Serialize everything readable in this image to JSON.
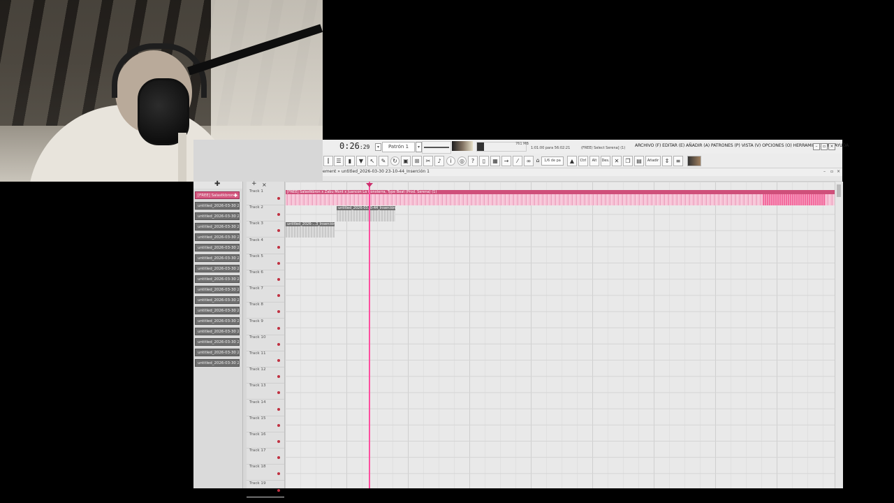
{
  "top_bar": {
    "time_main": "0:26",
    "time_sub": "29",
    "time_label": "M:S:CS",
    "pattern": "Patrón 1",
    "memory": "761 MB",
    "cpu_value": "72",
    "hint_time": "1:01:00 para 56:02:21",
    "hint_select": "(FREE) Select   Serena] (1)",
    "menu": "ARCHIVO (F)  EDITAR (E)  AÑADIR (A)  PATRONES (P)  VISTA (V)  OPCIONES (O)  HERRAMIENTAS (T)  AYUDA",
    "snap": "1/6 de pa"
  },
  "toolbar": {
    "icons": [
      "mixer-icon",
      "playlist-icon",
      "piano-icon",
      "plugin-icon",
      "cursor-icon",
      "brush-icon",
      "loop-icon",
      "save-icon",
      "cut-icon",
      "scissors-icon",
      "mic-icon",
      "info-icon",
      "help-icon",
      "question-icon",
      "doc-icon",
      "keyboard-icon",
      "arrow-right-icon",
      "pencil-icon",
      "link-icon"
    ],
    "right_buttons": [
      "Ctrl",
      "Alt",
      "Des.",
      "Añadir"
    ]
  },
  "playlist": {
    "breadcrumb": "ement » untitled_2026-03-30 23-10-44_Inserción 1"
  },
  "left_panel": {
    "clips": [
      {
        "label": "[FREE] Salastkbron a...",
        "active": true
      },
      {
        "label": "untitled_2026-03-30 23-...",
        "active": false
      },
      {
        "label": "untitled_2026-03-30 23-...",
        "active": false
      },
      {
        "label": "untitled_2026-03-30 23-...",
        "active": false
      },
      {
        "label": "untitled_2026-03-30 23-...",
        "active": false
      },
      {
        "label": "untitled_2026-03-30 23-...",
        "active": false
      },
      {
        "label": "untitled_2026-03-30 23-...",
        "active": false
      },
      {
        "label": "untitled_2026-03-30 23-...",
        "active": false
      },
      {
        "label": "untitled_2026-03-30 23-...",
        "active": false
      },
      {
        "label": "untitled_2026-03-30 23-...",
        "active": false
      },
      {
        "label": "untitled_2026-03-30 23-...",
        "active": false
      },
      {
        "label": "untitled_2026-03-30 23-...",
        "active": false
      },
      {
        "label": "untitled_2026-03-30 23-...",
        "active": false
      },
      {
        "label": "untitled_2026-03-30 23-...",
        "active": false
      },
      {
        "label": "untitled_2026-03-30 23-...",
        "active": false
      },
      {
        "label": "untitled_2026-03-30 23-...",
        "active": false
      },
      {
        "label": "untitled_2026-03-30 23-...",
        "active": false
      }
    ]
  },
  "tracks": [
    "Track 1",
    "Track 2",
    "Track 3",
    "Track 4",
    "Track 5",
    "Track 6",
    "Track 7",
    "Track 8",
    "Track 9",
    "Track 10",
    "Track 11",
    "Track 12",
    "Track 13",
    "Track 14",
    "Track 15",
    "Track 16",
    "Track 17",
    "Track 18",
    "Track 19"
  ],
  "playlist_clips": {
    "main": "[FREE] Salastkbron x Zabu Mont x Juancon La Gonsterra, Type Beat (Prod. Serena) (1)",
    "clip_a": "untitled_2026-03..0-44_Inserción1",
    "clip_b": "untitled_2026-...3_Inserción1"
  },
  "colors": {
    "accent": "#d4567e",
    "playhead": "#ff4fa0",
    "clip_grey": "#707070"
  }
}
